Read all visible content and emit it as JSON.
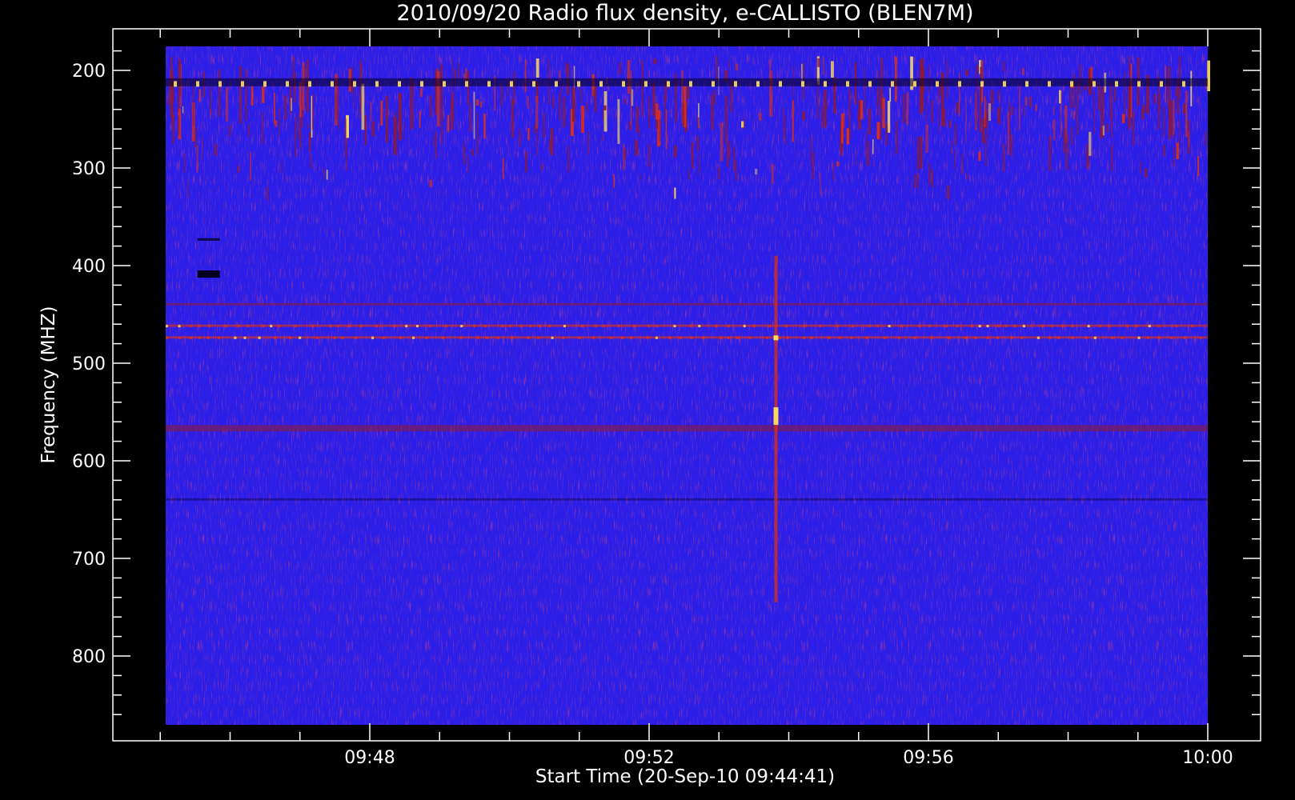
{
  "chart_data": {
    "type": "heatmap",
    "title": "2010/09/20  Radio flux density, e-CALLISTO (BLEN7M)",
    "xlabel": "Start Time (20-Sep-10 09:44:41)",
    "ylabel": "Frequency (MHZ)",
    "x_tick_labels": [
      "09:48",
      "09:52",
      "09:56",
      "10:00"
    ],
    "y_tick_labels": [
      "200",
      "300",
      "400",
      "500",
      "600",
      "700",
      "800"
    ],
    "x_range_start": "09:44:41",
    "x_range_end": "10:00:00",
    "y_range_mhz": [
      178,
      870
    ],
    "y_axis_inverted": true,
    "grid": false,
    "colors": {
      "background_field": "#2a1ee8",
      "emission_low": "#8a1a3a",
      "emission_mid": "#e03010",
      "emission_high": "#ffe060",
      "absorption": "#050020"
    },
    "features": {
      "burst_time": "09:53:49",
      "burst_freq_range_mhz": [
        390,
        745
      ],
      "burst_core_freq_mhz": 555,
      "interference_lines_mhz": [
        440,
        462,
        474,
        565,
        640
      ],
      "emission_band_mhz": [
        185,
        330
      ]
    }
  }
}
